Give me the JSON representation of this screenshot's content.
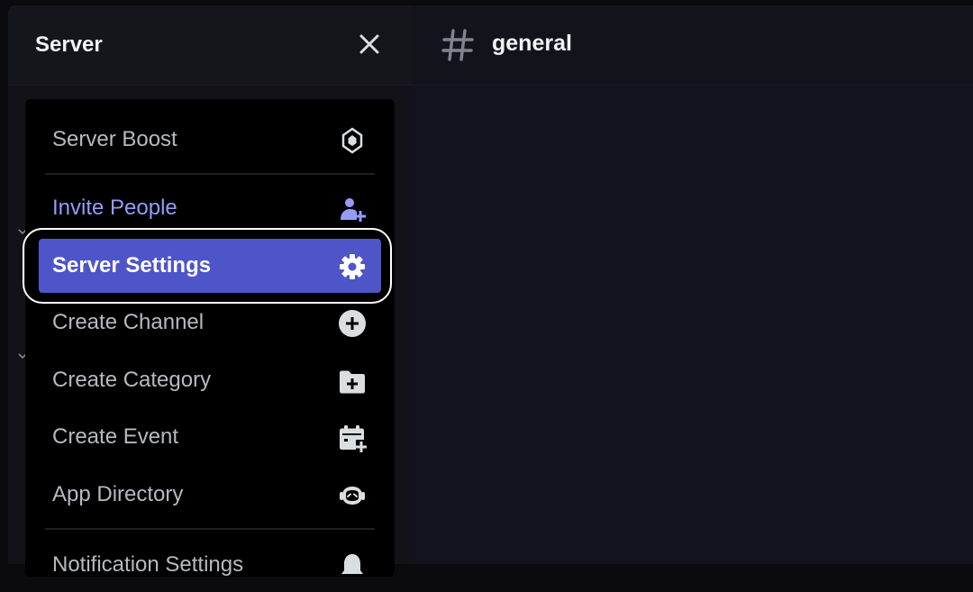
{
  "sidebar": {
    "server_name": "Server",
    "close_icon": "close-icon"
  },
  "channel": {
    "icon": "hash-icon",
    "name": "general"
  },
  "menu": {
    "items": [
      {
        "label": "Server Boost",
        "icon": "boost-icon"
      },
      {
        "label": "Invite People",
        "icon": "invite-user-icon"
      },
      {
        "label": "Server Settings",
        "icon": "gear-icon",
        "active": true
      },
      {
        "label": "Create Channel",
        "icon": "plus-circle-icon"
      },
      {
        "label": "Create Category",
        "icon": "folder-plus-icon"
      },
      {
        "label": "Create Event",
        "icon": "calendar-plus-icon"
      },
      {
        "label": "App Directory",
        "icon": "app-directory-icon"
      },
      {
        "label": "Notification Settings",
        "icon": "bell-icon"
      }
    ]
  },
  "colors": {
    "accent": "#4e55c8",
    "invite_text": "#949cf7",
    "menu_text": "#b5bac1"
  }
}
